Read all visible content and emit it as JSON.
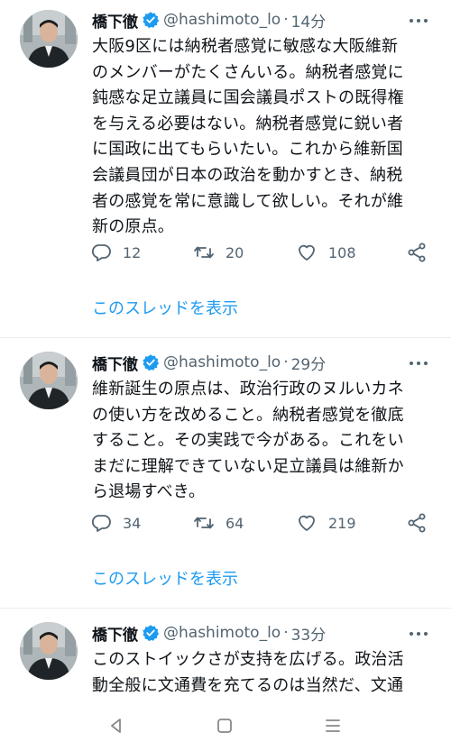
{
  "tweets": [
    {
      "name": "橋下徹",
      "handle": "@hashimoto_lo",
      "dot": "·",
      "time": "14分",
      "text": "大阪9区には納税者感覚に敏感な大阪維新\nのメンバーがたくさんいる。納税者感覚に\n鈍感な足立議員に国会議員ポストの既得権\nを与える必要はない。納税者感覚に鋭い者\nに国政に出てもらいたい。これから維新国\n会議員団が日本の政治を動かすとき、納税\n者の感覚を常に意識して欲しい。それが維\n新の原点。",
      "replies": "12",
      "retweets": "20",
      "likes": "108",
      "thread_link": "このスレッドを表示"
    },
    {
      "name": "橋下徹",
      "handle": "@hashimoto_lo",
      "dot": "·",
      "time": "29分",
      "text": "維新誕生の原点は、政治行政のヌルいカネ\nの使い方を改めること。納税者感覚を徹底\nすること。その実践で今がある。これをい\nまだに理解できていない足立議員は維新か\nら退場すべき。",
      "replies": "34",
      "retweets": "64",
      "likes": "219",
      "thread_link": "このスレッドを表示"
    },
    {
      "name": "橋下徹",
      "handle": "@hashimoto_lo",
      "dot": "·",
      "time": "33分",
      "text": "このストイックさが支持を広げる。政治活\n動全般に文通費を充てるのは当然だ、文通"
    }
  ],
  "icons": {
    "verified": "verified-badge-icon",
    "more": "more-dots-icon",
    "reply": "reply-icon",
    "retweet": "retweet-icon",
    "like": "heart-icon",
    "share": "share-icon",
    "nav_back": "back-triangle-icon",
    "nav_home": "home-square-icon",
    "nav_recents": "recents-lines-icon"
  },
  "colors": {
    "link": "#1d9bf0",
    "secondary_text": "#536471",
    "verified": "#1d9bf0",
    "divider": "#e6ecf0"
  }
}
